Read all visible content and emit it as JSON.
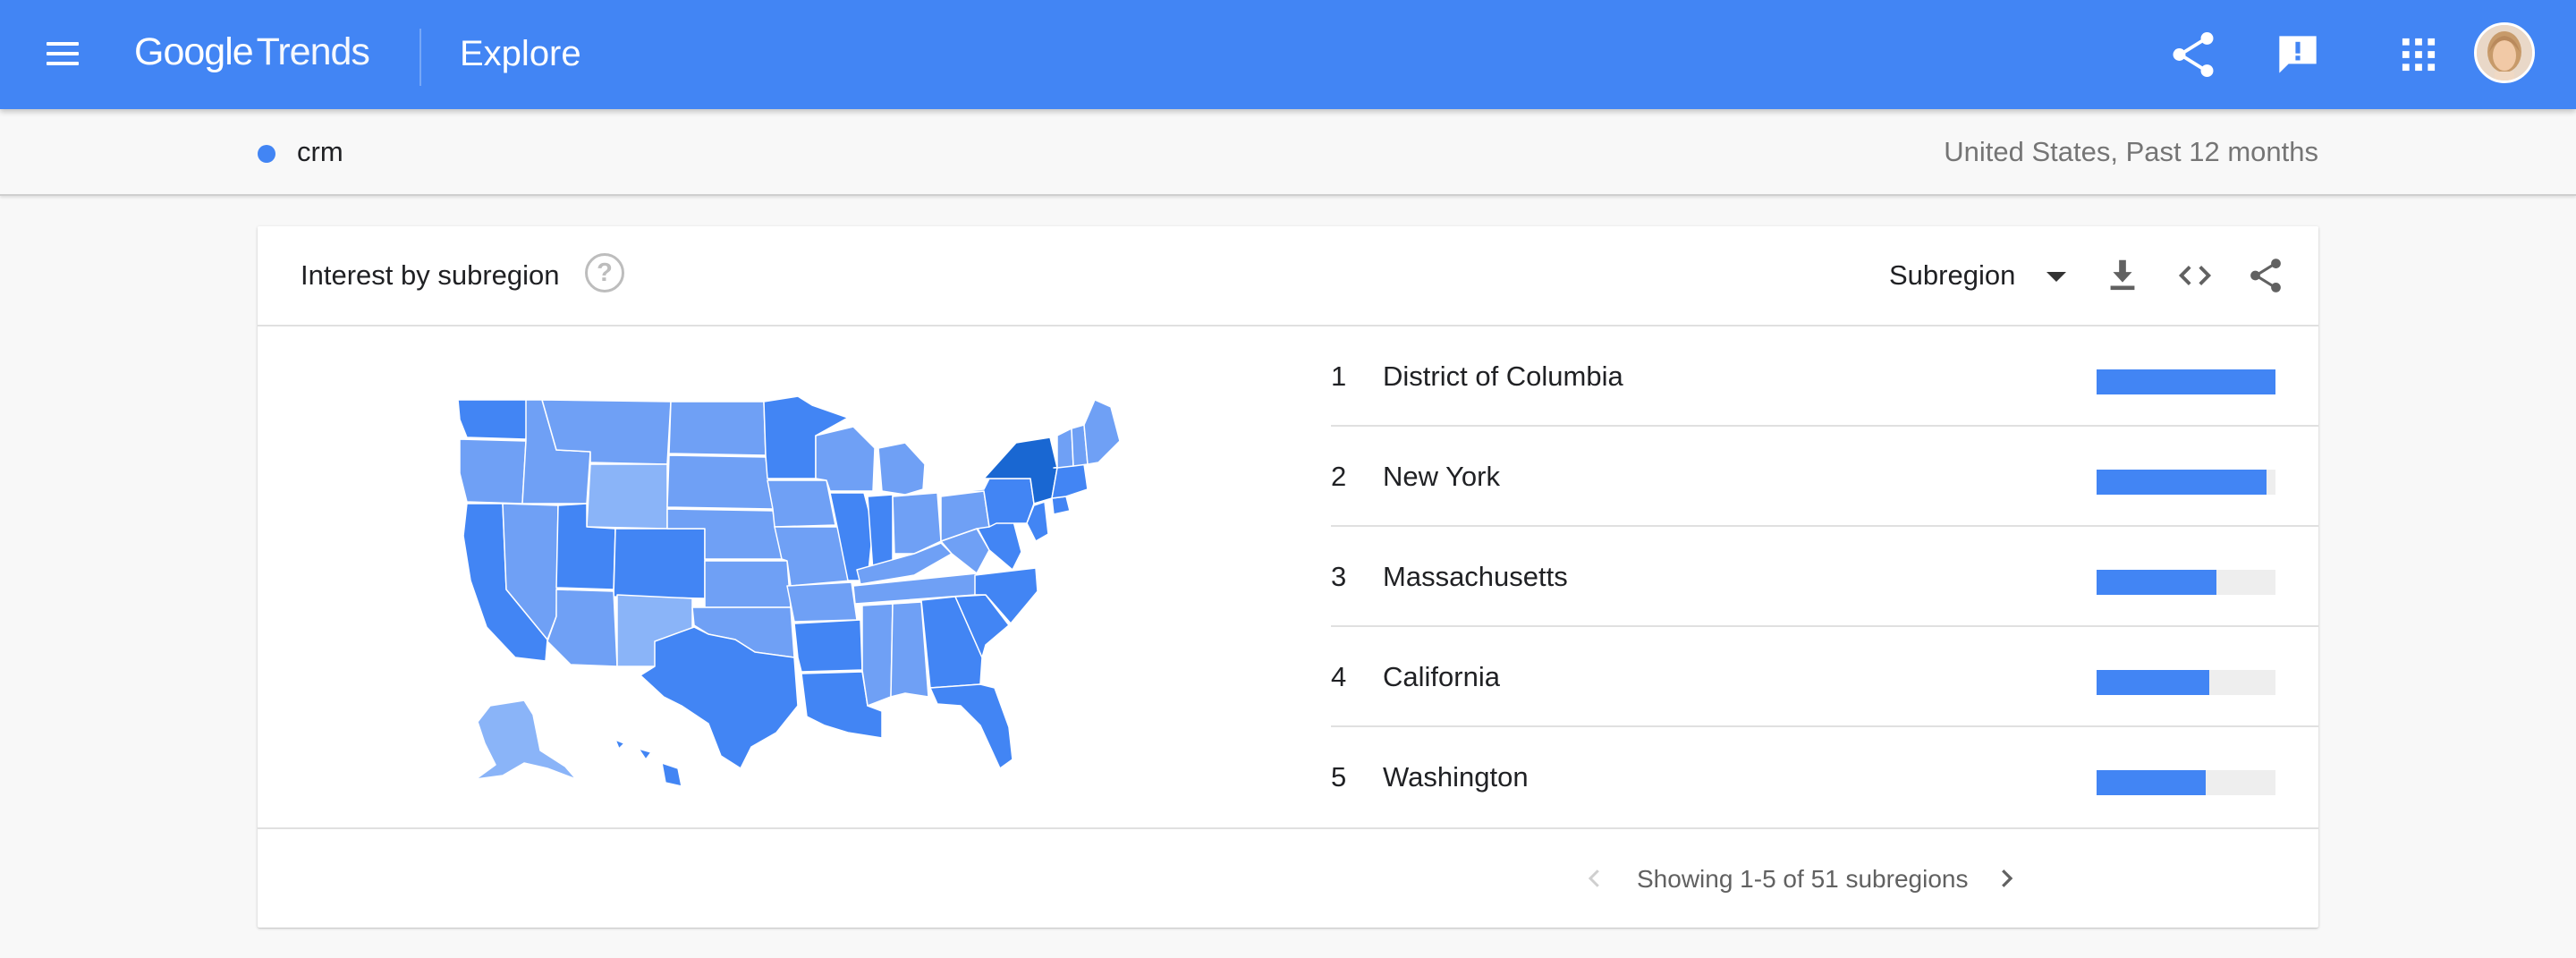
{
  "header": {
    "logo_google": "Google",
    "logo_trends": "Trends",
    "title": "Explore",
    "icons": [
      "menu-icon",
      "share-icon",
      "feedback-icon",
      "apps-icon",
      "avatar"
    ]
  },
  "search": {
    "term": "crm",
    "term_color": "#4285f4",
    "scope": "United States, Past 12 months"
  },
  "card": {
    "title": "Interest by subregion",
    "help_glyph": "?",
    "dropdown_label": "Subregion",
    "rows": [
      {
        "rank": "1",
        "name": "District of Columbia",
        "value": "100",
        "fraction": 1.0
      },
      {
        "rank": "2",
        "name": "New York",
        "value": "95",
        "fraction": 0.95
      },
      {
        "rank": "3",
        "name": "Massachusetts",
        "value": "67",
        "fraction": 0.67
      },
      {
        "rank": "4",
        "name": "California",
        "value": "63",
        "fraction": 0.63
      },
      {
        "rank": "5",
        "name": "Washington",
        "value": "61",
        "fraction": 0.61
      }
    ],
    "pager": "Showing 1-5 of 51 subregions"
  },
  "map": {
    "region": "United States",
    "scale_colors": [
      "#1967d2",
      "#4285f4",
      "#6fa0f5",
      "#8ab4f8"
    ]
  },
  "colors": {
    "appbar": "#4285f4",
    "bar_fill": "#4285f4",
    "bar_track": "#eeeeee"
  }
}
